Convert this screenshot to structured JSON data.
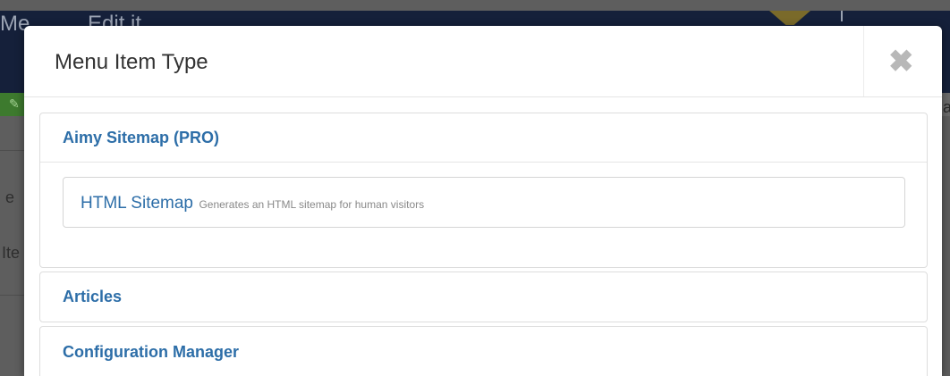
{
  "background": {
    "title_fragment_1": "Me",
    "title_fragment_2": "Edit it",
    "side_letter_1": "e",
    "side_letter_2": "Ite",
    "right_letter": "a"
  },
  "modal": {
    "title": "Menu Item Type",
    "close_glyph": "✖"
  },
  "groups": [
    {
      "label": "Aimy Sitemap (PRO)",
      "expanded": true,
      "items": [
        {
          "title": "HTML Sitemap",
          "description": "Generates an HTML sitemap for human visitors"
        }
      ]
    },
    {
      "label": "Articles",
      "expanded": false
    },
    {
      "label": "Configuration Manager",
      "expanded": false
    }
  ],
  "colors": {
    "link_blue": "#2d6ea8",
    "overlay": "#5e5e5e",
    "topbar": "#15203a"
  }
}
